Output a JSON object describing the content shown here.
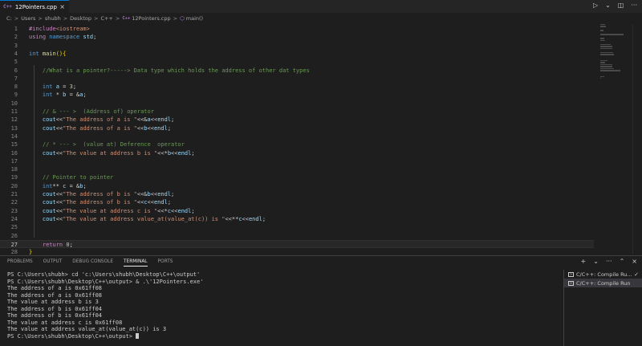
{
  "tab": {
    "lang_badge": "C++",
    "filename": "12Pointers.cpp",
    "close": "×"
  },
  "toolbar": {
    "run": "▷",
    "run_dropdown": "⌄",
    "split": "◫",
    "more": "···"
  },
  "breadcrumb": {
    "items": [
      "C:",
      "Users",
      "shubh",
      "Desktop",
      "C++",
      "12Pointers.cpp",
      "main()"
    ],
    "separator": ">"
  },
  "editor": {
    "active_line": 27,
    "lines": [
      {
        "n": "1",
        "tokens": [
          {
            "t": "#include",
            "c": "pp"
          },
          {
            "t": "<iostream>",
            "c": "inc"
          }
        ]
      },
      {
        "n": "2",
        "tokens": [
          {
            "t": "using ",
            "c": "pp"
          },
          {
            "t": "namespace ",
            "c": "kw"
          },
          {
            "t": "std",
            "c": "var"
          },
          {
            "t": ";",
            "c": "op"
          }
        ]
      },
      {
        "n": "3",
        "tokens": []
      },
      {
        "n": "4",
        "tokens": [
          {
            "t": "int ",
            "c": "kw"
          },
          {
            "t": "main",
            "c": "fn"
          },
          {
            "t": "(){",
            "c": "br"
          }
        ]
      },
      {
        "n": "5",
        "tokens": []
      },
      {
        "n": "6",
        "tokens": [
          {
            "t": "    //What is a pointer?-----> Data type which holds the address of other dat types",
            "c": "cm"
          }
        ]
      },
      {
        "n": "7",
        "tokens": []
      },
      {
        "n": "8",
        "tokens": [
          {
            "t": "    int ",
            "c": "kw"
          },
          {
            "t": "a",
            "c": "var"
          },
          {
            "t": " = ",
            "c": "op"
          },
          {
            "t": "3",
            "c": "num"
          },
          {
            "t": ";",
            "c": "op"
          }
        ]
      },
      {
        "n": "9",
        "tokens": [
          {
            "t": "    int ",
            "c": "kw"
          },
          {
            "t": "* ",
            "c": "op"
          },
          {
            "t": "b",
            "c": "var"
          },
          {
            "t": " = &",
            "c": "op"
          },
          {
            "t": "a",
            "c": "var"
          },
          {
            "t": ";",
            "c": "op"
          }
        ]
      },
      {
        "n": "10",
        "tokens": []
      },
      {
        "n": "11",
        "tokens": [
          {
            "t": "    // & --- >  (Address of) operator",
            "c": "cm"
          }
        ]
      },
      {
        "n": "12",
        "tokens": [
          {
            "t": "    cout",
            "c": "var"
          },
          {
            "t": "<<",
            "c": "op"
          },
          {
            "t": "\"The address of a is \"",
            "c": "str"
          },
          {
            "t": "<<&",
            "c": "op"
          },
          {
            "t": "a",
            "c": "var"
          },
          {
            "t": "<<",
            "c": "op"
          },
          {
            "t": "endl",
            "c": "var"
          },
          {
            "t": ";",
            "c": "op"
          }
        ]
      },
      {
        "n": "13",
        "tokens": [
          {
            "t": "    cout",
            "c": "var"
          },
          {
            "t": "<<",
            "c": "op"
          },
          {
            "t": "\"The address of a is \"",
            "c": "str"
          },
          {
            "t": "<<",
            "c": "op"
          },
          {
            "t": "b",
            "c": "var"
          },
          {
            "t": "<<",
            "c": "op"
          },
          {
            "t": "endl",
            "c": "var"
          },
          {
            "t": ";",
            "c": "op"
          }
        ]
      },
      {
        "n": "14",
        "tokens": []
      },
      {
        "n": "15",
        "tokens": [
          {
            "t": "    // * --- >  (value at) Deference  operator",
            "c": "cm"
          }
        ]
      },
      {
        "n": "16",
        "tokens": [
          {
            "t": "    cout",
            "c": "var"
          },
          {
            "t": "<<",
            "c": "op"
          },
          {
            "t": "\"The value at address b is \"",
            "c": "str"
          },
          {
            "t": "<<*",
            "c": "op"
          },
          {
            "t": "b",
            "c": "var"
          },
          {
            "t": "<<",
            "c": "op"
          },
          {
            "t": "endl",
            "c": "var"
          },
          {
            "t": ";",
            "c": "op"
          }
        ]
      },
      {
        "n": "17",
        "tokens": []
      },
      {
        "n": "18",
        "tokens": []
      },
      {
        "n": "19",
        "tokens": [
          {
            "t": "    // Pointer to pointer",
            "c": "cm"
          }
        ]
      },
      {
        "n": "20",
        "tokens": [
          {
            "t": "    int",
            "c": "kw"
          },
          {
            "t": "** ",
            "c": "op"
          },
          {
            "t": "c",
            "c": "var"
          },
          {
            "t": " = &",
            "c": "op"
          },
          {
            "t": "b",
            "c": "var"
          },
          {
            "t": ";",
            "c": "op"
          }
        ]
      },
      {
        "n": "21",
        "tokens": [
          {
            "t": "    cout",
            "c": "var"
          },
          {
            "t": "<<",
            "c": "op"
          },
          {
            "t": "\"The address of b is \"",
            "c": "str"
          },
          {
            "t": "<<&",
            "c": "op"
          },
          {
            "t": "b",
            "c": "var"
          },
          {
            "t": "<<",
            "c": "op"
          },
          {
            "t": "endl",
            "c": "var"
          },
          {
            "t": ";",
            "c": "op"
          }
        ]
      },
      {
        "n": "22",
        "tokens": [
          {
            "t": "    cout",
            "c": "var"
          },
          {
            "t": "<<",
            "c": "op"
          },
          {
            "t": "\"The address of b is \"",
            "c": "str"
          },
          {
            "t": "<<",
            "c": "op"
          },
          {
            "t": "c",
            "c": "var"
          },
          {
            "t": "<<",
            "c": "op"
          },
          {
            "t": "endl",
            "c": "var"
          },
          {
            "t": ";",
            "c": "op"
          }
        ]
      },
      {
        "n": "23",
        "tokens": [
          {
            "t": "    cout",
            "c": "var"
          },
          {
            "t": "<<",
            "c": "op"
          },
          {
            "t": "\"The value at address c is \"",
            "c": "str"
          },
          {
            "t": "<<*",
            "c": "op"
          },
          {
            "t": "c",
            "c": "var"
          },
          {
            "t": "<<",
            "c": "op"
          },
          {
            "t": "endl",
            "c": "var"
          },
          {
            "t": ";",
            "c": "op"
          }
        ]
      },
      {
        "n": "24",
        "tokens": [
          {
            "t": "    cout",
            "c": "var"
          },
          {
            "t": "<<",
            "c": "op"
          },
          {
            "t": "\"The value at address value_at(value_at(c)) is \"",
            "c": "str"
          },
          {
            "t": "<<**",
            "c": "op"
          },
          {
            "t": "c",
            "c": "var"
          },
          {
            "t": "<<",
            "c": "op"
          },
          {
            "t": "endl",
            "c": "var"
          },
          {
            "t": ";",
            "c": "op"
          }
        ]
      },
      {
        "n": "25",
        "tokens": []
      },
      {
        "n": "26",
        "tokens": []
      },
      {
        "n": "27",
        "tokens": [
          {
            "t": "    return ",
            "c": "pp"
          },
          {
            "t": "0",
            "c": "num"
          },
          {
            "t": ";",
            "c": "op"
          }
        ]
      },
      {
        "n": "28",
        "tokens": [
          {
            "t": "}",
            "c": "br"
          }
        ]
      }
    ]
  },
  "panel": {
    "tabs": [
      "PROBLEMS",
      "OUTPUT",
      "DEBUG CONSOLE",
      "TERMINAL",
      "PORTS"
    ],
    "active_tab": "TERMINAL",
    "actions": {
      "new_terminal": "+",
      "dropdown": "⌄",
      "more": "···",
      "maximize": "⌃",
      "close": "×"
    },
    "terminal_lines": [
      "PS C:\\Users\\shubh> cd 'c:\\Users\\shubh\\Desktop\\C++\\output'",
      "PS C:\\Users\\shubh\\Desktop\\C++\\output> & .\\'12Pointers.exe'",
      "The address of a is 0x61ff08",
      "The address of a is 0x61ff08",
      "The value at address b is 3",
      "The address of b is 0x61ff04",
      "The address of b is 0x61ff04",
      "The value at address c is 0x61ff08",
      "The value at address value_at(value_at(c)) is 3"
    ],
    "prompt": "PS C:\\Users\\shubh\\Desktop\\C++\\output> ",
    "terminal_list": [
      {
        "label": "C/C++: Compile Ru...",
        "check": "✓"
      },
      {
        "label": "C/C++: Compile Run"
      }
    ]
  }
}
